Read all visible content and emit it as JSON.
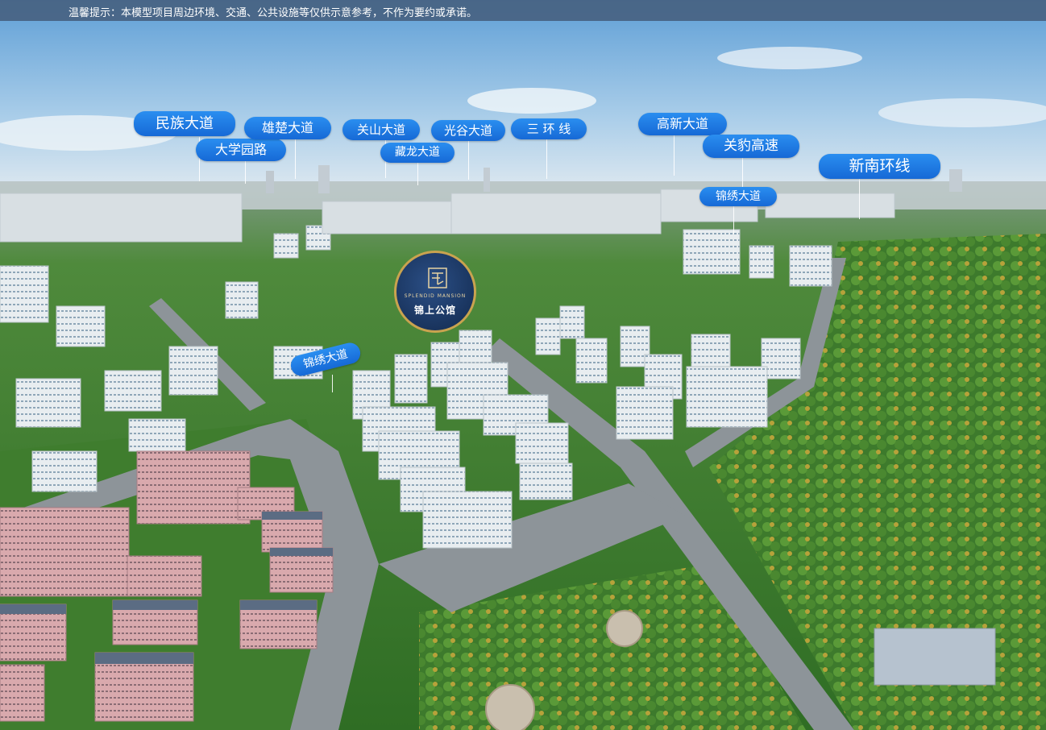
{
  "notice": "温馨提示：本模型项目周边环境、交通、公共设施等仅供示意参考，不作为要约或承诺。",
  "labels": {
    "minzu": "民族大道",
    "daxue": "大学园路",
    "xiongchu": "雄楚大道",
    "guanshan": "关山大道",
    "canglong": "藏龙大道",
    "guanggu": "光谷大道",
    "sanhuan": "三 环 线",
    "gaoxin": "高新大道",
    "guanbao": "关豹高速",
    "xinnan": "新南环线",
    "jinxiu_right": "锦绣大道",
    "jinxiu_left": "锦绣大道"
  },
  "logo": {
    "en": "SPLENDID MANSION",
    "cn": "锦上公馆"
  },
  "colors": {
    "label_blue": "#1e7be6",
    "logo_navy": "#16305a",
    "logo_gold": "#c9a34f"
  }
}
